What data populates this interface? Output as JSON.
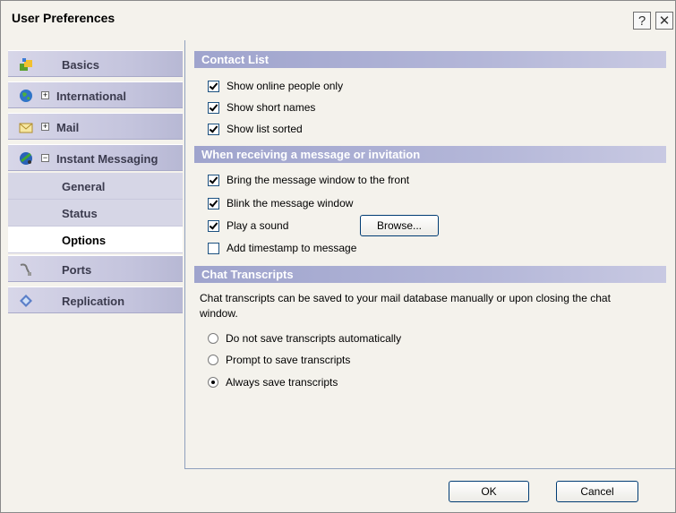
{
  "window": {
    "title": "User Preferences",
    "help_glyph": "?",
    "close_glyph": "✕"
  },
  "sidebar": {
    "items": [
      {
        "label": "Basics",
        "icon": "basics-icon"
      },
      {
        "label": "International",
        "icon": "globe-icon",
        "expander": "+"
      },
      {
        "label": "Mail",
        "icon": "mail-icon",
        "expander": "+"
      },
      {
        "label": "Instant Messaging",
        "icon": "instant-messaging-icon",
        "expander": "−"
      },
      {
        "label": "General"
      },
      {
        "label": "Status"
      },
      {
        "label": "Options",
        "selected": true
      },
      {
        "label": "Ports",
        "icon": "ports-icon"
      },
      {
        "label": "Replication",
        "icon": "replication-icon"
      }
    ]
  },
  "contact_list": {
    "header": "Contact List",
    "options": [
      {
        "label": "Show online people only",
        "checked": true
      },
      {
        "label": "Show short names",
        "checked": true
      },
      {
        "label": "Show list sorted",
        "checked": true
      }
    ]
  },
  "receiving": {
    "header": "When receiving a message or invitation",
    "options": [
      {
        "label": "Bring the message window to the front",
        "checked": true
      },
      {
        "label": "Blink the message window",
        "checked": true
      },
      {
        "label": "Play a sound",
        "checked": true
      },
      {
        "label": "Add timestamp to message",
        "checked": false
      }
    ],
    "browse_label": "Browse..."
  },
  "transcripts": {
    "header": "Chat Transcripts",
    "description": "Chat transcripts can be saved to your mail database manually or upon closing the chat window.",
    "options": [
      {
        "label": "Do not save transcripts automatically",
        "selected": false
      },
      {
        "label": "Prompt to save transcripts",
        "selected": false
      },
      {
        "label": "Always save transcripts",
        "selected": true
      }
    ]
  },
  "footer": {
    "ok_label": "OK",
    "cancel_label": "Cancel"
  }
}
